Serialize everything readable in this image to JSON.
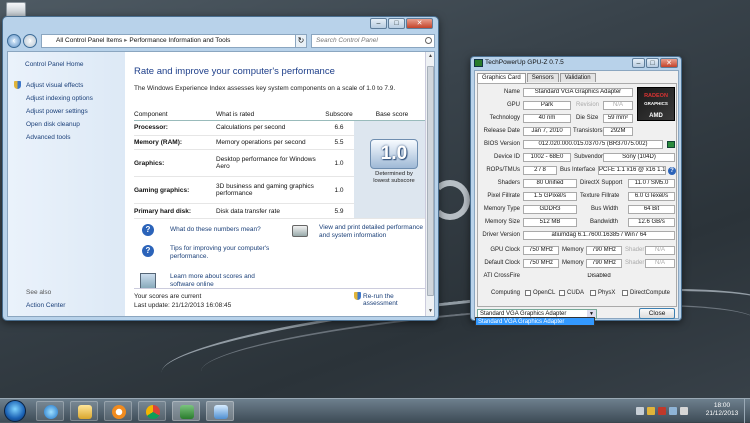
{
  "control_panel": {
    "address": [
      "All Control Panel Items",
      "Performance Information and Tools"
    ],
    "search_placeholder": "Search Control Panel",
    "sidebar": {
      "home": "Control Panel Home",
      "links": [
        "Adjust visual effects",
        "Adjust indexing options",
        "Adjust power settings",
        "Open disk cleanup",
        "Advanced tools"
      ],
      "see_also": "See also",
      "action_center": "Action Center"
    },
    "heading": "Rate and improve your computer's performance",
    "intro": "The Windows Experience Index assesses key system components on a scale of 1.0 to 7.9.",
    "table": {
      "headers": [
        "Component",
        "What is rated",
        "Subscore",
        "Base score"
      ],
      "rows": [
        {
          "component": "Processor:",
          "rated": "Calculations per second",
          "subscore": "6.6"
        },
        {
          "component": "Memory (RAM):",
          "rated": "Memory operations per second",
          "subscore": "5.5"
        },
        {
          "component": "Graphics:",
          "rated": "Desktop performance for Windows Aero",
          "subscore": "1.0"
        },
        {
          "component": "Gaming graphics:",
          "rated": "3D business and gaming graphics performance",
          "subscore": "1.0"
        },
        {
          "component": "Primary hard disk:",
          "rated": "Disk data transfer rate",
          "subscore": "5.9"
        }
      ]
    },
    "base_score": "1.0",
    "base_score_caption": "Determined by lowest subscore",
    "help_links": {
      "numbers": "What do these numbers mean?",
      "tips": "Tips for improving your computer's performance.",
      "print": "View and print detailed performance and system information",
      "learn": "Learn more about scores and software online"
    },
    "footer": {
      "current": "Your scores are current",
      "last_update": "Last update: 21/12/2013 16:08:45",
      "rerun": "Re-run the assessment"
    }
  },
  "gpuz": {
    "title": "TechPowerUp GPU-Z 0.7.5",
    "tabs": [
      "Graphics Card",
      "Sensors",
      "Validation"
    ],
    "logo_text": "RADEON",
    "logo_sub": "GRAPHICS",
    "logo_brand": "AMD",
    "name_label": "Name",
    "name": "Standard VGA Graphics Adapter",
    "gpu_label": "GPU",
    "gpu": "Park",
    "revision_label": "Revision",
    "revision": "N/A",
    "tech_label": "Technology",
    "tech": "40 nm",
    "die_label": "Die Size",
    "die": "59 mm²",
    "release_label": "Release Date",
    "release": "Jan 7, 2010",
    "trans_label": "Transistors",
    "trans": "292M",
    "bios_label": "BIOS Version",
    "bios": "012.020.000.015.037075 (BR37075.002)",
    "devid_label": "Device ID",
    "devid": "1002 - 68E0",
    "subv_label": "Subvendor",
    "subv": "Sony (104D)",
    "rops_label": "ROPs/TMUs",
    "rops": "2 / 8",
    "bus_label": "Bus Interface",
    "bus": "PCI-E 1.1 x16 @ x16 1.1",
    "shaders_label": "Shaders",
    "shaders": "80 Unified",
    "dx_label": "DirectX Support",
    "dx": "11.0 / SM5.0",
    "pixel_label": "Pixel Fillrate",
    "pixel": "1.5 GPixel/s",
    "tex_label": "Texture Fillrate",
    "tex": "6.0 GTexel/s",
    "memtype_label": "Memory Type",
    "memtype": "GDDR3",
    "buswidth_label": "Bus Width",
    "buswidth": "64 Bit",
    "memsize_label": "Memory Size",
    "memsize": "512 MB",
    "bandwidth_label": "Bandwidth",
    "bandwidth": "12.6 GB/s",
    "driver_label": "Driver Version",
    "driver": "atiumdag 6.1.7600.16385 / Win7 64",
    "gpuclock_label": "GPU Clock",
    "gpuclock": "750 MHz",
    "mem_label": "Memory",
    "memclock": "790 MHz",
    "shader_label": "Shader",
    "shader": "N/A",
    "defclock_label": "Default Clock",
    "defclock": "750 MHz",
    "defmem": "790 MHz",
    "defshader": "N/A",
    "crossfire_label": "ATI CrossFire",
    "crossfire": "Disabled",
    "computing_label": "Computing",
    "computing": [
      "OpenCL",
      "CUDA",
      "PhysX",
      "DirectCompute"
    ],
    "selected_adapter": "Standard VGA Graphics Adapter",
    "close_label": "Close"
  },
  "taskbar": {
    "time": "18:00",
    "date": "21/12/2013"
  }
}
